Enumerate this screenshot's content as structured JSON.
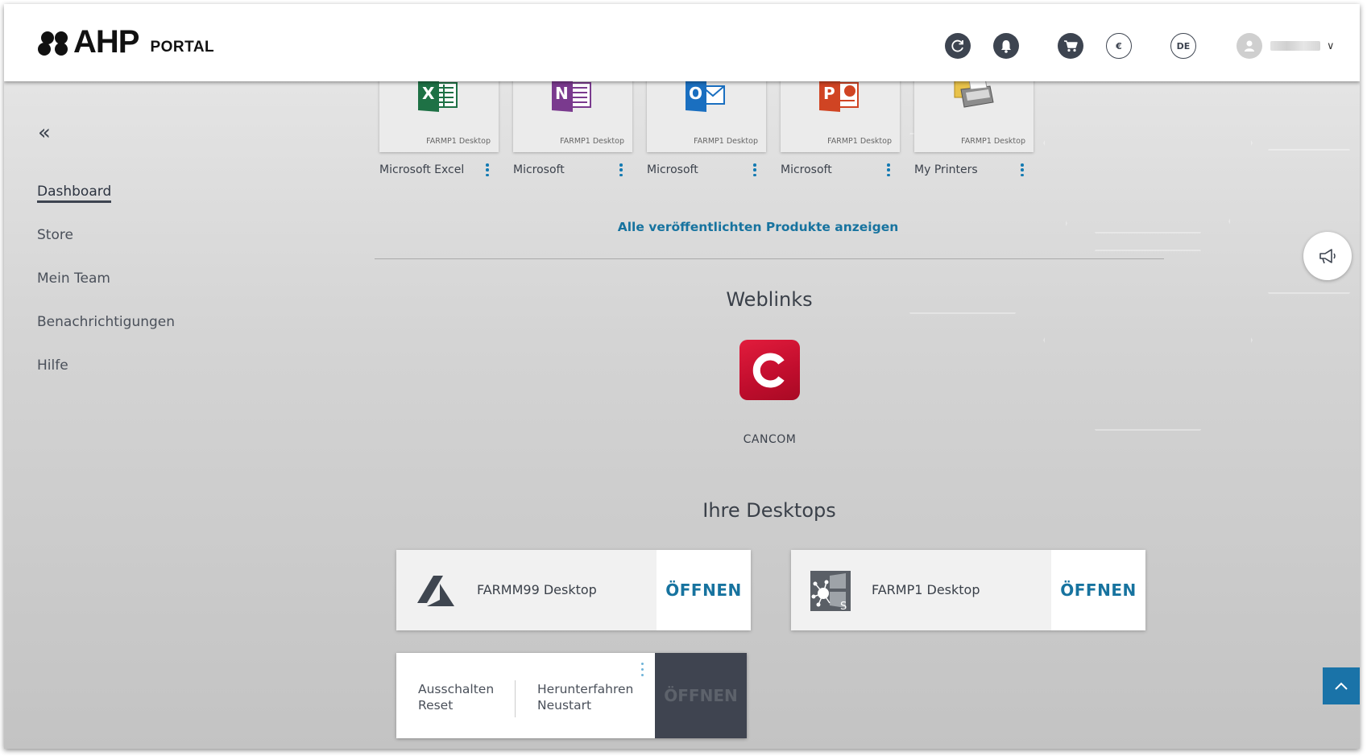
{
  "header": {
    "logo_text": "AHP",
    "logo_sub": "PORTAL",
    "currency_label": "€",
    "language_label": "DE"
  },
  "sidebar": {
    "items": [
      {
        "label": "Dashboard",
        "active": true
      },
      {
        "label": "Store"
      },
      {
        "label": "Mein Team"
      },
      {
        "label": "Benachrichtigungen"
      },
      {
        "label": "Hilfe"
      }
    ]
  },
  "apps": [
    {
      "name": "Microsoft Excel",
      "source": "FARMP1 Desktop",
      "icon": "excel-icon"
    },
    {
      "name": "Microsoft",
      "source": "FARMP1 Desktop",
      "icon": "onenote-icon"
    },
    {
      "name": "Microsoft",
      "source": "FARMP1 Desktop",
      "icon": "outlook-icon"
    },
    {
      "name": "Microsoft",
      "source": "FARMP1 Desktop",
      "icon": "powerpoint-icon"
    },
    {
      "name": "My Printers",
      "source": "FARMP1 Desktop",
      "icon": "printer-icon"
    }
  ],
  "show_all_link": "Alle veröffentlichten Produkte anzeigen",
  "weblinks": {
    "title": "Weblinks",
    "items": [
      {
        "label": "CANCOM",
        "icon": "cancom-icon"
      }
    ]
  },
  "desktops": {
    "title": "Ihre Desktops",
    "items": [
      {
        "name": "FARMM99 Desktop",
        "action": "ÖFFNEN",
        "icon": "azure-icon"
      },
      {
        "name": "FARMP1 Desktop",
        "action": "ÖFFNEN",
        "icon": "windows-server-icon"
      }
    ],
    "actions_card": {
      "left_1": "Ausschalten",
      "left_2": "Reset",
      "right_1": "Herunterfahren",
      "right_2": "Neustart",
      "action": "ÖFFNEN"
    }
  },
  "colors": {
    "accent": "#17739f",
    "dark": "#3d4450",
    "cancom_red": "#d0112f"
  }
}
